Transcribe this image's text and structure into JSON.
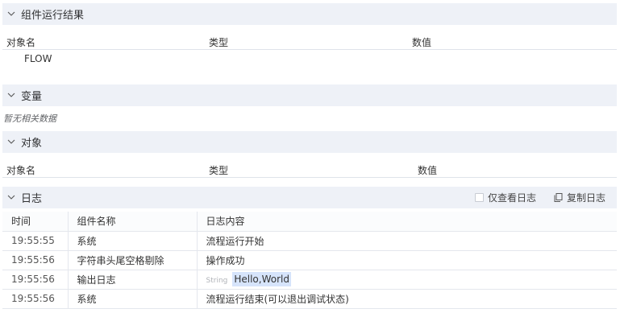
{
  "component_results": {
    "title": "组件运行结果",
    "columns": [
      "对象名",
      "类型",
      "数值"
    ],
    "rows": [
      {
        "name": "FLOW"
      }
    ]
  },
  "variables": {
    "title": "变量",
    "empty_text": "暂无相关数据"
  },
  "objects": {
    "title": "对象",
    "columns": [
      "对象名",
      "类型",
      "数值"
    ]
  },
  "logs": {
    "title": "日志",
    "only_view_logs_label": "仅查看日志",
    "copy_logs_label": "复制日志",
    "columns": [
      "时间",
      "组件名称",
      "日志内容"
    ],
    "rows": [
      {
        "time": "19:55:55",
        "component": "系统",
        "content": "流程运行开始"
      },
      {
        "time": "19:55:56",
        "component": "字符串头尾空格剔除",
        "content": "操作成功"
      },
      {
        "time": "19:55:56",
        "component": "输出日志",
        "type_tag": "String",
        "content": "Hello,World"
      },
      {
        "time": "19:55:56",
        "component": "系统",
        "content": "流程运行结束(可以退出调试状态)"
      }
    ]
  },
  "colors": {
    "section_header_bg": "#eef1f7",
    "highlight_bg": "#d6e4fb"
  }
}
